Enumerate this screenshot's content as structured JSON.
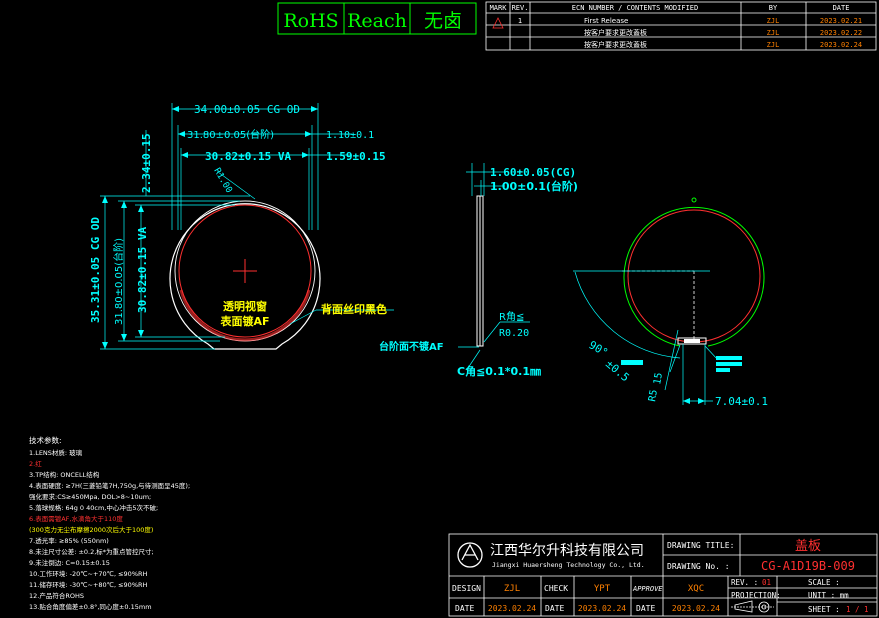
{
  "compliance": {
    "rohs": "RoHS",
    "reach": "Reach",
    "halogen": "无卤"
  },
  "revision_table": {
    "headers": {
      "mark": "MARK",
      "rev": "REV.",
      "ecn": "ECN NUMBER / CONTENTS MODIFIED",
      "by": "BY",
      "date": "DATE"
    },
    "rev_number": "1",
    "rows": [
      {
        "content": "First Release",
        "by": "ZJL",
        "date": "2023.02.21"
      },
      {
        "content": "按客户要求更改蓋板",
        "by": "ZJL",
        "date": "2023.02.22"
      },
      {
        "content": "按客户要求更改蓋板",
        "by": "ZJL",
        "date": "2023.02.24"
      }
    ]
  },
  "dimensions": {
    "cg_width": "34.00±0.05 CG OD",
    "step_width": "31.80±0.05(台阶)",
    "step_offset": "1.10±0.1",
    "va_width": "30.82±0.15 VA",
    "va_offset": "1.59±0.15",
    "top_offset": "2.34±0.15",
    "radius": "R1.00",
    "cg_height": "35.31±0.05 CG OD",
    "step_height": "31.80±0.05(台阶)",
    "va_height": "30.82±0.15 VA",
    "cg_thickness": "1.60±0.05(CG)",
    "step_thickness": "1.00±0.1(台阶)",
    "r_corner": "R角≦",
    "r_value": "R0.20",
    "c_corner": "C角≦0.1*0.1㎜",
    "angle": "90°",
    "angle_tol": "±0.5",
    "dim_15": "15",
    "dim_r5": "R5",
    "dim_704": "7.04±0.1"
  },
  "callouts": {
    "window_line1": "透明视窗",
    "window_line2": "表面镀AF",
    "back_print": "背面丝印黑色",
    "step_no_af": "台阶面不镀AF"
  },
  "tech_params": {
    "title": "技术参数:",
    "lines": [
      {
        "text": "1.LENS材质: 玻璃",
        "color": "#ffffff"
      },
      {
        "text": "2.红",
        "color": "#ff3030"
      },
      {
        "text": "3.TP结构: ONCELL结构",
        "color": "#ffffff"
      },
      {
        "text": "4.表面硬度: ≥7H(三菱铅笔7H,750g,与待测面呈45度);",
        "color": "#ffffff"
      },
      {
        "text": "强化要求:CS≥450Mpa, DOL>8~10um;",
        "color": "#ffffff"
      },
      {
        "text": "5.落球规格: 64g 0 40cm,中心冲击5次不破;",
        "color": "#ffffff"
      },
      {
        "text": "6.表面需镀AF,水滴角大于110度",
        "color": "#ff3030"
      },
      {
        "text": "(300克力无尘布摩擦2000次后大于100度)",
        "color": "#ffff00"
      },
      {
        "text": "7.透光率: ≥85% (550nm)",
        "color": "#ffffff"
      },
      {
        "text": "8.未注尺寸公差: ±0.2,标*为重点管控尺寸;",
        "color": "#ffffff"
      },
      {
        "text": "9.未注倒边: C=0.15±0.15",
        "color": "#ffffff"
      },
      {
        "text": "10.工作环境: -20℃~+70℃, ≤90%RH",
        "color": "#ffffff"
      },
      {
        "text": "11.储存环境: -30℃~+80℃, ≤90%RH",
        "color": "#ffffff"
      },
      {
        "text": "12.产品符合ROHS",
        "color": "#ffffff"
      },
      {
        "text": "13.贴合角度偏差±0.8°,同心度±0.15mm",
        "color": "#ffffff"
      }
    ]
  },
  "title_block": {
    "company_cn": "江西华尔升科技有限公司",
    "company_en": "Jiangxi Huaersheng Technology Co., Ltd.",
    "drawing_title_label": "DRAWING TITLE:",
    "drawing_title": "盖板",
    "drawing_no_label": "DRAWING No. :",
    "drawing_no": "CG-A1D19B-009",
    "rev_label": "REV. :",
    "rev_value": "01",
    "scale_label": "SCALE :",
    "projection_label": "PROJECTION:",
    "unit_label": "UNIT : mm",
    "sheet_label": "SHEET :",
    "sheet_value": "1 / 1",
    "design_label": "DESIGN",
    "design_value": "ZJL",
    "check_label": "CHECK",
    "check_value": "YPT",
    "approve_label": "APPROVE",
    "approve_value": "XQC",
    "date_label": "DATE",
    "design_date": "2023.02.24",
    "check_date": "2023.02.24",
    "approve_date": "2023.02.24"
  },
  "colors": {
    "outline": "#ffffff",
    "dimension": "#00ffff",
    "cg_edge": "#00ff00",
    "va_edge": "#ff3030",
    "value": "#ff8000",
    "callout": "#ffff00"
  }
}
